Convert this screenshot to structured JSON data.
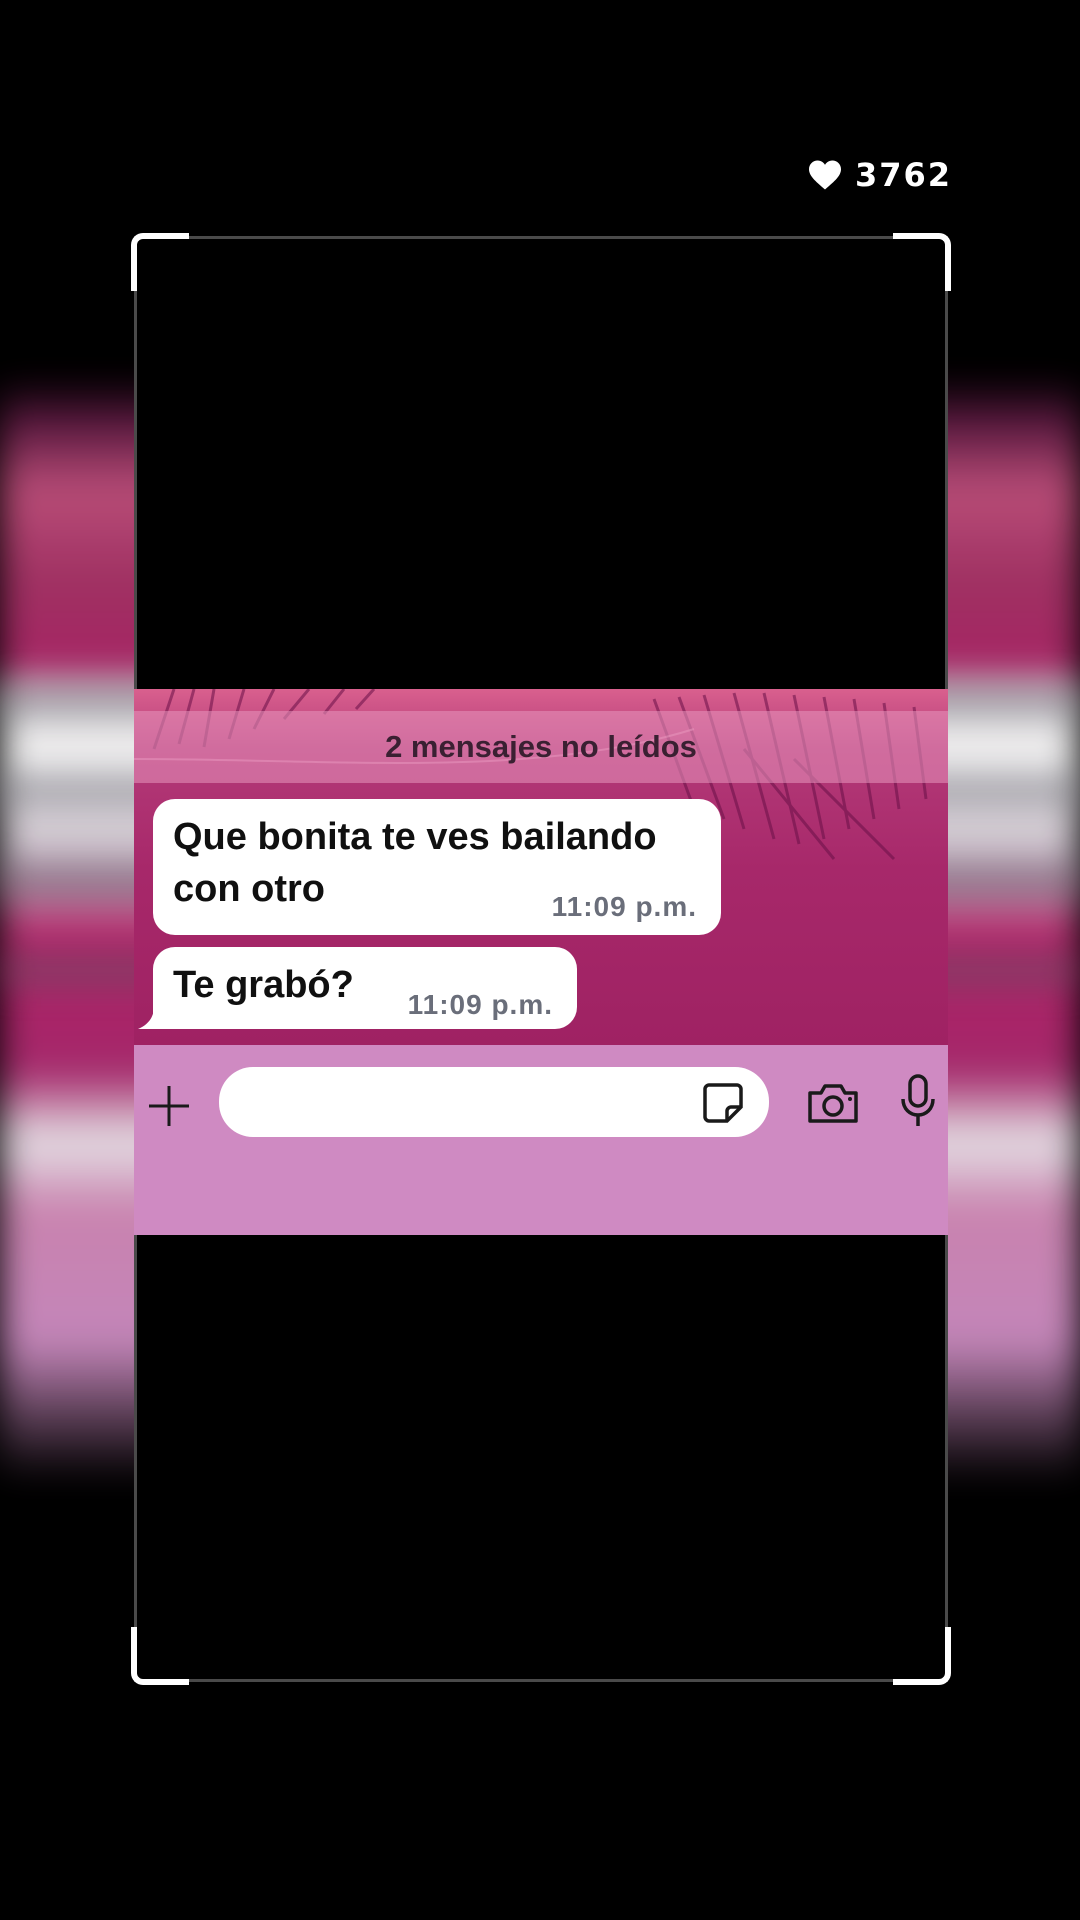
{
  "likes": {
    "icon": "heart-icon",
    "count": "3762"
  },
  "chat": {
    "unread_banner": "2 mensajes no leídos",
    "messages": [
      {
        "text": "Que bonita te ves bailando con otro",
        "time": "11:09 p.m."
      },
      {
        "text": "Te grabó?",
        "time": "11:09 p.m."
      }
    ],
    "input": {
      "value": "",
      "placeholder": ""
    },
    "icons": [
      "plus-icon",
      "sticker-icon",
      "camera-icon",
      "microphone-icon"
    ]
  },
  "colors": {
    "chat_background": "#a7286a",
    "input_bar": "#cf8ac2",
    "bubble": "#ffffff",
    "frame_corners": "#ffffff"
  }
}
